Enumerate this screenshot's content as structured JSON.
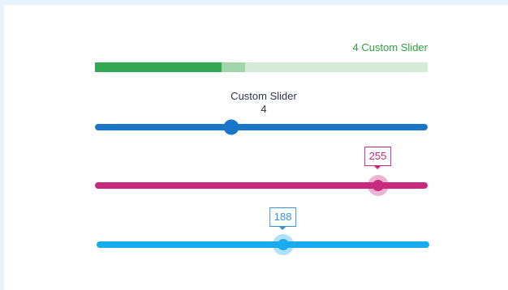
{
  "green_slider": {
    "label": "4 Custom Slider",
    "value_fraction": 0.38,
    "buffer_fraction": 0.45,
    "colors": {
      "fill": "#32a852",
      "buffer": "#9fd5a8",
      "track": "#d4ecd7"
    }
  },
  "blue_slider": {
    "title": "Custom Slider",
    "value_label": "4",
    "value_fraction": 0.41,
    "color": "#1976c9"
  },
  "magenta_slider": {
    "tooltip": "255",
    "value_fraction": 0.85,
    "color": "#c92a7e"
  },
  "cyan_slider": {
    "tooltip": "188",
    "value_fraction": 0.56,
    "color": "#1aaaf0"
  }
}
